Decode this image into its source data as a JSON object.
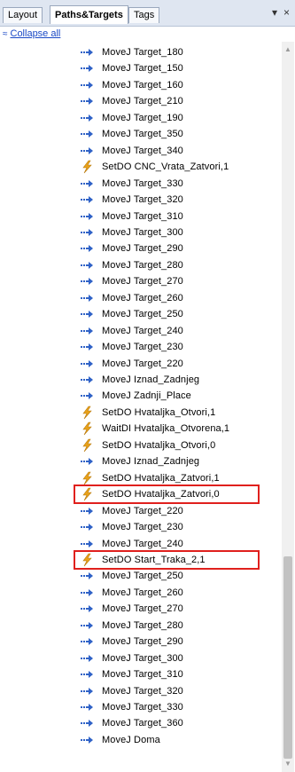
{
  "tabs": [
    {
      "label": "Layout"
    },
    {
      "label": "Paths&Targets"
    },
    {
      "label": "Tags"
    }
  ],
  "tab_controls": {
    "dropdown": "▾",
    "close": "×"
  },
  "collapse_all": {
    "label": "Collapse all",
    "chevron": "≈"
  },
  "icon_types": {
    "move": "arrow-move-icon",
    "io": "lightning-icon"
  },
  "colors": {
    "move_icon": "#2f62c7",
    "io_icon": "#e9a21a",
    "highlight": "#e0201d",
    "link": "#1a49c6"
  },
  "items": [
    {
      "label": "MoveJ Target_180",
      "type": "move"
    },
    {
      "label": "MoveJ Target_150",
      "type": "move"
    },
    {
      "label": "MoveJ Target_160",
      "type": "move"
    },
    {
      "label": "MoveJ Target_210",
      "type": "move"
    },
    {
      "label": "MoveJ Target_190",
      "type": "move"
    },
    {
      "label": "MoveJ Target_350",
      "type": "move"
    },
    {
      "label": "MoveJ Target_340",
      "type": "move"
    },
    {
      "label": "SetDO CNC_Vrata_Zatvori,1",
      "type": "io"
    },
    {
      "label": "MoveJ Target_330",
      "type": "move"
    },
    {
      "label": "MoveJ Target_320",
      "type": "move"
    },
    {
      "label": "MoveJ Target_310",
      "type": "move"
    },
    {
      "label": "MoveJ Target_300",
      "type": "move"
    },
    {
      "label": "MoveJ Target_290",
      "type": "move"
    },
    {
      "label": "MoveJ Target_280",
      "type": "move"
    },
    {
      "label": "MoveJ Target_270",
      "type": "move"
    },
    {
      "label": "MoveJ Target_260",
      "type": "move"
    },
    {
      "label": "MoveJ Target_250",
      "type": "move"
    },
    {
      "label": "MoveJ Target_240",
      "type": "move"
    },
    {
      "label": "MoveJ Target_230",
      "type": "move"
    },
    {
      "label": "MoveJ Target_220",
      "type": "move"
    },
    {
      "label": "MoveJ Iznad_Zadnjeg",
      "type": "move"
    },
    {
      "label": "MoveJ Zadnji_Place",
      "type": "move"
    },
    {
      "label": "SetDO Hvataljka_Otvori,1",
      "type": "io"
    },
    {
      "label": "WaitDI Hvataljka_Otvorena,1",
      "type": "io"
    },
    {
      "label": "SetDO Hvataljka_Otvori,0",
      "type": "io"
    },
    {
      "label": "MoveJ Iznad_Zadnjeg",
      "type": "move"
    },
    {
      "label": "SetDO Hvataljka_Zatvori,1",
      "type": "io"
    },
    {
      "label": "SetDO Hvataljka_Zatvori,0",
      "type": "io",
      "highlighted": true
    },
    {
      "label": "MoveJ Target_220",
      "type": "move"
    },
    {
      "label": "MoveJ Target_230",
      "type": "move"
    },
    {
      "label": "MoveJ Target_240",
      "type": "move"
    },
    {
      "label": "SetDO Start_Traka_2,1",
      "type": "io",
      "highlighted": true
    },
    {
      "label": "MoveJ Target_250",
      "type": "move"
    },
    {
      "label": "MoveJ Target_260",
      "type": "move"
    },
    {
      "label": "MoveJ Target_270",
      "type": "move"
    },
    {
      "label": "MoveJ Target_280",
      "type": "move"
    },
    {
      "label": "MoveJ Target_290",
      "type": "move"
    },
    {
      "label": "MoveJ Target_300",
      "type": "move"
    },
    {
      "label": "MoveJ Target_310",
      "type": "move"
    },
    {
      "label": "MoveJ Target_320",
      "type": "move"
    },
    {
      "label": "MoveJ Target_330",
      "type": "move"
    },
    {
      "label": "MoveJ Target_360",
      "type": "move"
    },
    {
      "label": "MoveJ Doma",
      "type": "move"
    }
  ]
}
